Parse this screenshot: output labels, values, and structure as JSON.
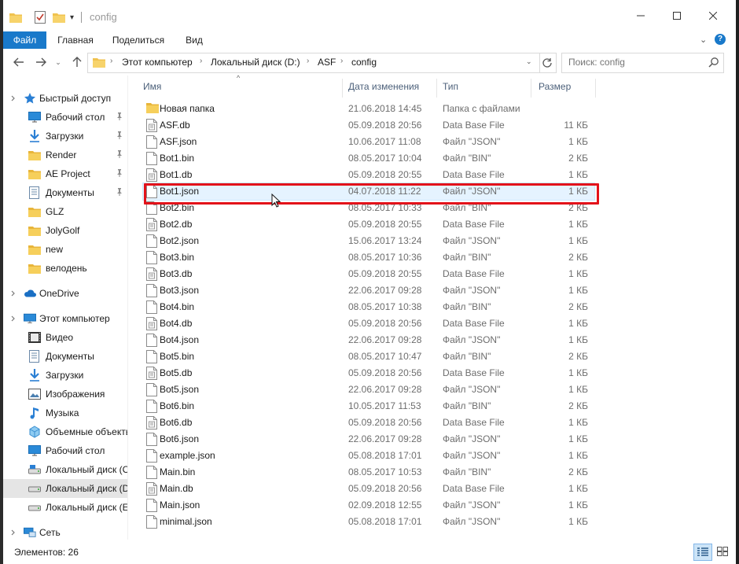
{
  "window": {
    "title": "config"
  },
  "ribbon": {
    "tabs": [
      "Файл",
      "Главная",
      "Поделиться",
      "Вид"
    ],
    "help": "?"
  },
  "address": {
    "crumbs": [
      "Этот компьютер",
      "Локальный диск (D:)",
      "ASF",
      "config"
    ],
    "search_placeholder": "Поиск: config"
  },
  "nav_pane": {
    "quick_access": "Быстрый доступ",
    "quick_items": [
      {
        "label": "Рабочий стол",
        "icon": "desktop-icon",
        "pinned": true
      },
      {
        "label": "Загрузки",
        "icon": "download-icon",
        "pinned": true
      },
      {
        "label": "Render",
        "icon": "folder-icon",
        "pinned": true
      },
      {
        "label": "AE Project",
        "icon": "folder-icon",
        "pinned": true
      },
      {
        "label": "Документы",
        "icon": "documents-icon",
        "pinned": true
      },
      {
        "label": "GLZ",
        "icon": "folder-icon",
        "pinned": false
      },
      {
        "label": "JolyGolf",
        "icon": "folder-icon",
        "pinned": false
      },
      {
        "label": "new",
        "icon": "folder-icon",
        "pinned": false
      },
      {
        "label": "велодень",
        "icon": "folder-icon",
        "pinned": false
      }
    ],
    "onedrive": "OneDrive",
    "this_pc": "Этот компьютер",
    "pc_items": [
      {
        "label": "Видео",
        "icon": "video-icon"
      },
      {
        "label": "Документы",
        "icon": "documents-icon"
      },
      {
        "label": "Загрузки",
        "icon": "download-icon"
      },
      {
        "label": "Изображения",
        "icon": "pictures-icon"
      },
      {
        "label": "Музыка",
        "icon": "music-icon"
      },
      {
        "label": "Объемные объекты",
        "icon": "3d-objects-icon"
      },
      {
        "label": "Рабочий стол",
        "icon": "desktop-icon"
      },
      {
        "label": "Локальный диск (C:)",
        "icon": "drive-c-icon"
      },
      {
        "label": "Локальный диск (D:)",
        "icon": "drive-icon",
        "selected": true
      },
      {
        "label": "Локальный диск (E:)",
        "icon": "drive-icon"
      }
    ],
    "network": "Сеть"
  },
  "columns": {
    "name": "Имя",
    "date": "Дата изменения",
    "type": "Тип",
    "size": "Размер"
  },
  "files": [
    {
      "name": "Новая папка",
      "date": "21.06.2018 14:45",
      "type": "Папка с файлами",
      "size": "",
      "kind": "folder"
    },
    {
      "name": "ASF.db",
      "date": "05.09.2018 20:56",
      "type": "Data Base File",
      "size": "11 КБ",
      "kind": "db"
    },
    {
      "name": "ASF.json",
      "date": "10.06.2017 11:08",
      "type": "Файл \"JSON\"",
      "size": "1 КБ",
      "kind": "file"
    },
    {
      "name": "Bot1.bin",
      "date": "08.05.2017 10:04",
      "type": "Файл \"BIN\"",
      "size": "2 КБ",
      "kind": "file"
    },
    {
      "name": "Bot1.db",
      "date": "05.09.2018 20:55",
      "type": "Data Base File",
      "size": "1 КБ",
      "kind": "db"
    },
    {
      "name": "Bot1.json",
      "date": "04.07.2018 11:22",
      "type": "Файл \"JSON\"",
      "size": "1 КБ",
      "kind": "file",
      "highlight": true
    },
    {
      "name": "Bot2.bin",
      "date": "08.05.2017 10:33",
      "type": "Файл \"BIN\"",
      "size": "2 КБ",
      "kind": "file"
    },
    {
      "name": "Bot2.db",
      "date": "05.09.2018 20:55",
      "type": "Data Base File",
      "size": "1 КБ",
      "kind": "db"
    },
    {
      "name": "Bot2.json",
      "date": "15.06.2017 13:24",
      "type": "Файл \"JSON\"",
      "size": "1 КБ",
      "kind": "file"
    },
    {
      "name": "Bot3.bin",
      "date": "08.05.2017 10:36",
      "type": "Файл \"BIN\"",
      "size": "2 КБ",
      "kind": "file"
    },
    {
      "name": "Bot3.db",
      "date": "05.09.2018 20:55",
      "type": "Data Base File",
      "size": "1 КБ",
      "kind": "db"
    },
    {
      "name": "Bot3.json",
      "date": "22.06.2017 09:28",
      "type": "Файл \"JSON\"",
      "size": "1 КБ",
      "kind": "file"
    },
    {
      "name": "Bot4.bin",
      "date": "08.05.2017 10:38",
      "type": "Файл \"BIN\"",
      "size": "2 КБ",
      "kind": "file"
    },
    {
      "name": "Bot4.db",
      "date": "05.09.2018 20:56",
      "type": "Data Base File",
      "size": "1 КБ",
      "kind": "db"
    },
    {
      "name": "Bot4.json",
      "date": "22.06.2017 09:28",
      "type": "Файл \"JSON\"",
      "size": "1 КБ",
      "kind": "file"
    },
    {
      "name": "Bot5.bin",
      "date": "08.05.2017 10:47",
      "type": "Файл \"BIN\"",
      "size": "2 КБ",
      "kind": "file"
    },
    {
      "name": "Bot5.db",
      "date": "05.09.2018 20:56",
      "type": "Data Base File",
      "size": "1 КБ",
      "kind": "db"
    },
    {
      "name": "Bot5.json",
      "date": "22.06.2017 09:28",
      "type": "Файл \"JSON\"",
      "size": "1 КБ",
      "kind": "file"
    },
    {
      "name": "Bot6.bin",
      "date": "10.05.2017 11:53",
      "type": "Файл \"BIN\"",
      "size": "2 КБ",
      "kind": "file"
    },
    {
      "name": "Bot6.db",
      "date": "05.09.2018 20:56",
      "type": "Data Base File",
      "size": "1 КБ",
      "kind": "db"
    },
    {
      "name": "Bot6.json",
      "date": "22.06.2017 09:28",
      "type": "Файл \"JSON\"",
      "size": "1 КБ",
      "kind": "file"
    },
    {
      "name": "example.json",
      "date": "05.08.2018 17:01",
      "type": "Файл \"JSON\"",
      "size": "1 КБ",
      "kind": "file"
    },
    {
      "name": "Main.bin",
      "date": "08.05.2017 10:53",
      "type": "Файл \"BIN\"",
      "size": "2 КБ",
      "kind": "file"
    },
    {
      "name": "Main.db",
      "date": "05.09.2018 20:56",
      "type": "Data Base File",
      "size": "1 КБ",
      "kind": "db"
    },
    {
      "name": "Main.json",
      "date": "02.09.2018 12:55",
      "type": "Файл \"JSON\"",
      "size": "1 КБ",
      "kind": "file"
    },
    {
      "name": "minimal.json",
      "date": "05.08.2018 17:01",
      "type": "Файл \"JSON\"",
      "size": "1 КБ",
      "kind": "file"
    }
  ],
  "status": {
    "items_count": "Элементов: 26"
  },
  "colors": {
    "accent": "#1979ca",
    "highlight_border": "#e3121a",
    "folder": "#f0c24f"
  }
}
